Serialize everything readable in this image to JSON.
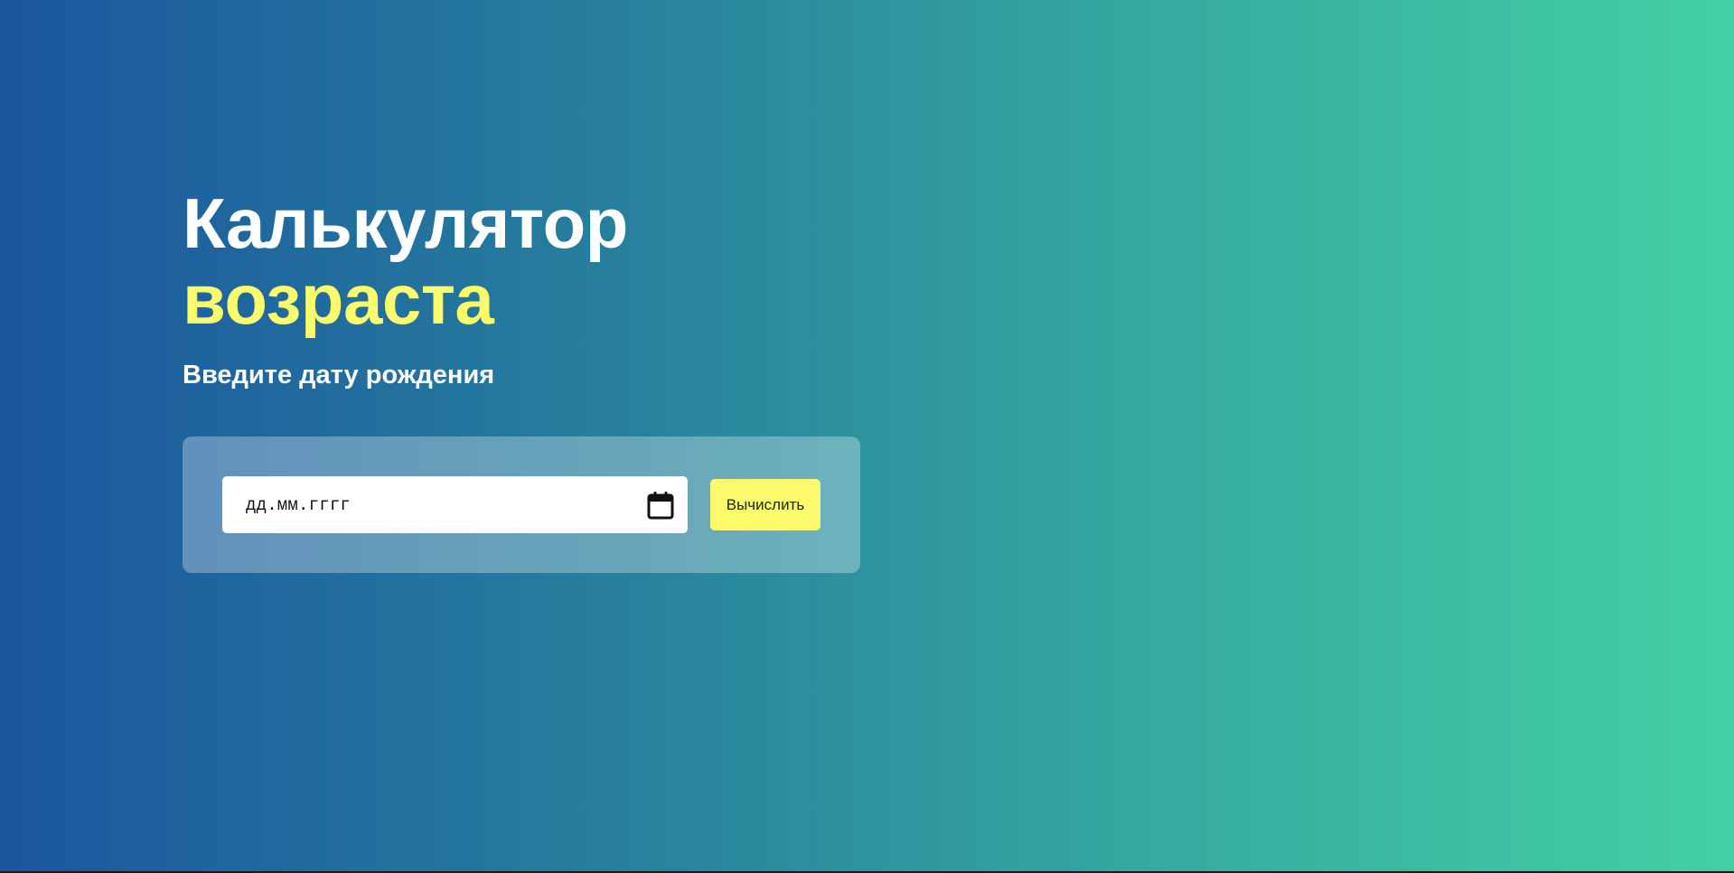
{
  "hero": {
    "title_line1": "Калькулятор",
    "title_line2": "возраста",
    "subtitle": "Введите дату рождения"
  },
  "form": {
    "date_input": {
      "placeholder": "дд.мм.гггг",
      "value": "",
      "icon": "calendar-icon"
    },
    "submit_label": "Вычислить"
  },
  "colors": {
    "gradient_start": "#1b569f",
    "gradient_end": "#42d0a3",
    "accent": "#fbfb6b",
    "text": "#ffffff"
  }
}
